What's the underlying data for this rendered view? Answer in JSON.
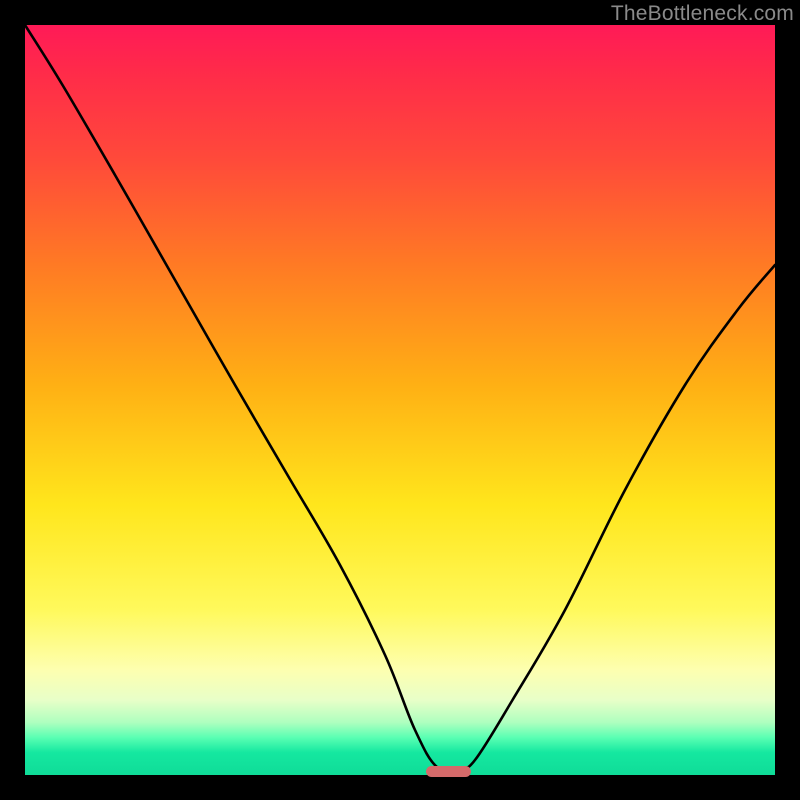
{
  "watermark": "TheBottleneck.com",
  "chart_data": {
    "type": "line",
    "title": "",
    "xlabel": "",
    "ylabel": "",
    "xlim": [
      0,
      100
    ],
    "ylim": [
      0,
      100
    ],
    "grid": false,
    "legend": false,
    "series": [
      {
        "name": "bottleneck-curve",
        "x": [
          0,
          5,
          12,
          20,
          28,
          35,
          42,
          48,
          52,
          55,
          58,
          60,
          65,
          72,
          80,
          88,
          95,
          100
        ],
        "values": [
          100,
          92,
          80,
          66,
          52,
          40,
          28,
          16,
          6,
          1,
          1,
          2,
          10,
          22,
          38,
          52,
          62,
          68
        ]
      }
    ],
    "marker": {
      "x_center": 56.5,
      "y": 0.5,
      "width_pct": 6,
      "height_pct": 1.4,
      "color": "#d46a6a"
    },
    "background_gradient": {
      "top": "#ff1a57",
      "mid": "#ffe61c",
      "bottom": "#0fdc98"
    }
  }
}
